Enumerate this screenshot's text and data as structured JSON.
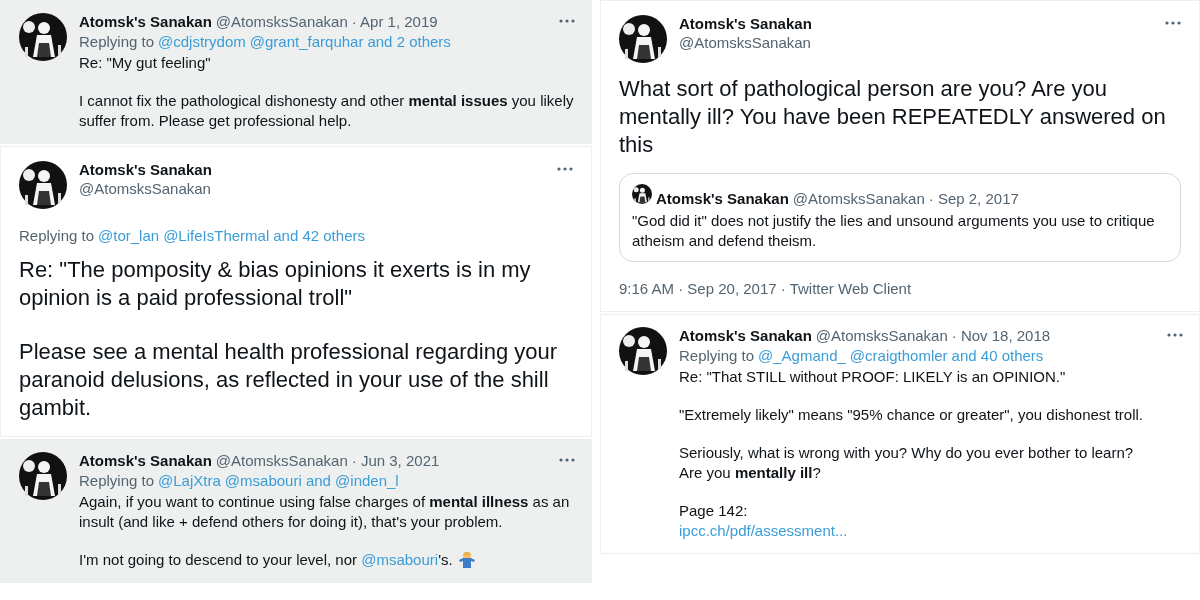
{
  "columns": [
    [
      {
        "kind": "compact",
        "shaded": true,
        "name": "Atomsk's Sanakan",
        "handle": "@AtomsksSanakan",
        "date": "· Apr 1, 2019",
        "replying": {
          "label": "Replying to",
          "links": [
            "@cdjstrydom",
            "@grant_farquhar",
            "and 2 others"
          ]
        },
        "paragraphs": [
          [
            {
              "kind": "text",
              "text": "Re: \"My gut feeling\""
            }
          ],
          [
            {
              "kind": "text",
              "text": "I cannot fix the pathological dishonesty and other **mental issues** you likely suffer from. Please get professional help."
            }
          ]
        ]
      },
      {
        "kind": "expanded",
        "shaded": false,
        "name": "Atomsk's Sanakan",
        "handle": "@AtomsksSanakan",
        "replying": {
          "label": "Replying to",
          "links": [
            "@tor_lan",
            "@LifeIsThermal",
            "and 42 others"
          ]
        },
        "paragraphs": [
          [
            {
              "kind": "text",
              "text": "Re: \"The pomposity & bias opinions it exerts is in my opinion is a paid professional troll\""
            }
          ],
          [
            {
              "kind": "text",
              "text": "Please see a mental health professional regarding your paranoid delusions, as reflected in your use of the shill gambit."
            }
          ]
        ]
      },
      {
        "kind": "compact",
        "shaded": true,
        "name": "Atomsk's Sanakan",
        "handle": "@AtomsksSanakan",
        "date": "· Jun 3, 2021",
        "replying": {
          "label": "Replying to",
          "links": [
            "@LajXtra",
            "@msabouri and @inden_l"
          ]
        },
        "paragraphs": [
          [
            {
              "kind": "text",
              "text": "Again, if you want to continue using false charges of **mental illness** as an insult (and like + defend others for doing it), that's your problem."
            }
          ],
          [
            {
              "kind": "text",
              "text": "I'm not going to descend to your level, nor "
            },
            {
              "kind": "link",
              "text": "@msabouri"
            },
            {
              "kind": "text",
              "text": "'s."
            },
            {
              "kind": "emoji"
            }
          ]
        ]
      }
    ],
    [
      {
        "kind": "expanded",
        "shaded": false,
        "name": "Atomsk's Sanakan",
        "handle": "@AtomsksSanakan",
        "paragraphs": [
          [
            {
              "kind": "text",
              "text": "What sort of pathological person are you? Are you mentally ill? You have been REPEATEDLY answered on this"
            }
          ]
        ],
        "quote": {
          "name": "Atomsk's Sanakan",
          "handle": "@AtomsksSanakan",
          "date": "· Sep 2, 2017",
          "text": "\"God did it\" does not justify the lies and unsound arguments you use to critique atheism and defend theism."
        },
        "footer": "9:16 AM · Sep 20, 2017 · Twitter Web Client"
      },
      {
        "kind": "compact",
        "shaded": false,
        "name": "Atomsk's Sanakan",
        "handle": "@AtomsksSanakan",
        "date": "· Nov 18, 2018",
        "replying": {
          "label": "Replying to",
          "links": [
            "@_Agmand_",
            "@craigthomler",
            "and 40 others"
          ]
        },
        "paragraphs": [
          [
            {
              "kind": "text",
              "text": "Re: \"That STILL without PROOF:  LIKELY is an OPINION.\""
            }
          ],
          [
            {
              "kind": "text",
              "text": "\"Extremely likely\" means \"95% chance or greater\", you dishonest troll."
            }
          ],
          [
            {
              "kind": "text",
              "text": "Seriously, what is wrong with you? Why do you ever bother to learn?\nAre you **mentally ill**?"
            }
          ],
          [
            {
              "kind": "text",
              "text": "Page 142:\n"
            },
            {
              "kind": "link",
              "text": "ipcc.ch/pdf/assessment..."
            }
          ]
        ]
      }
    ]
  ]
}
